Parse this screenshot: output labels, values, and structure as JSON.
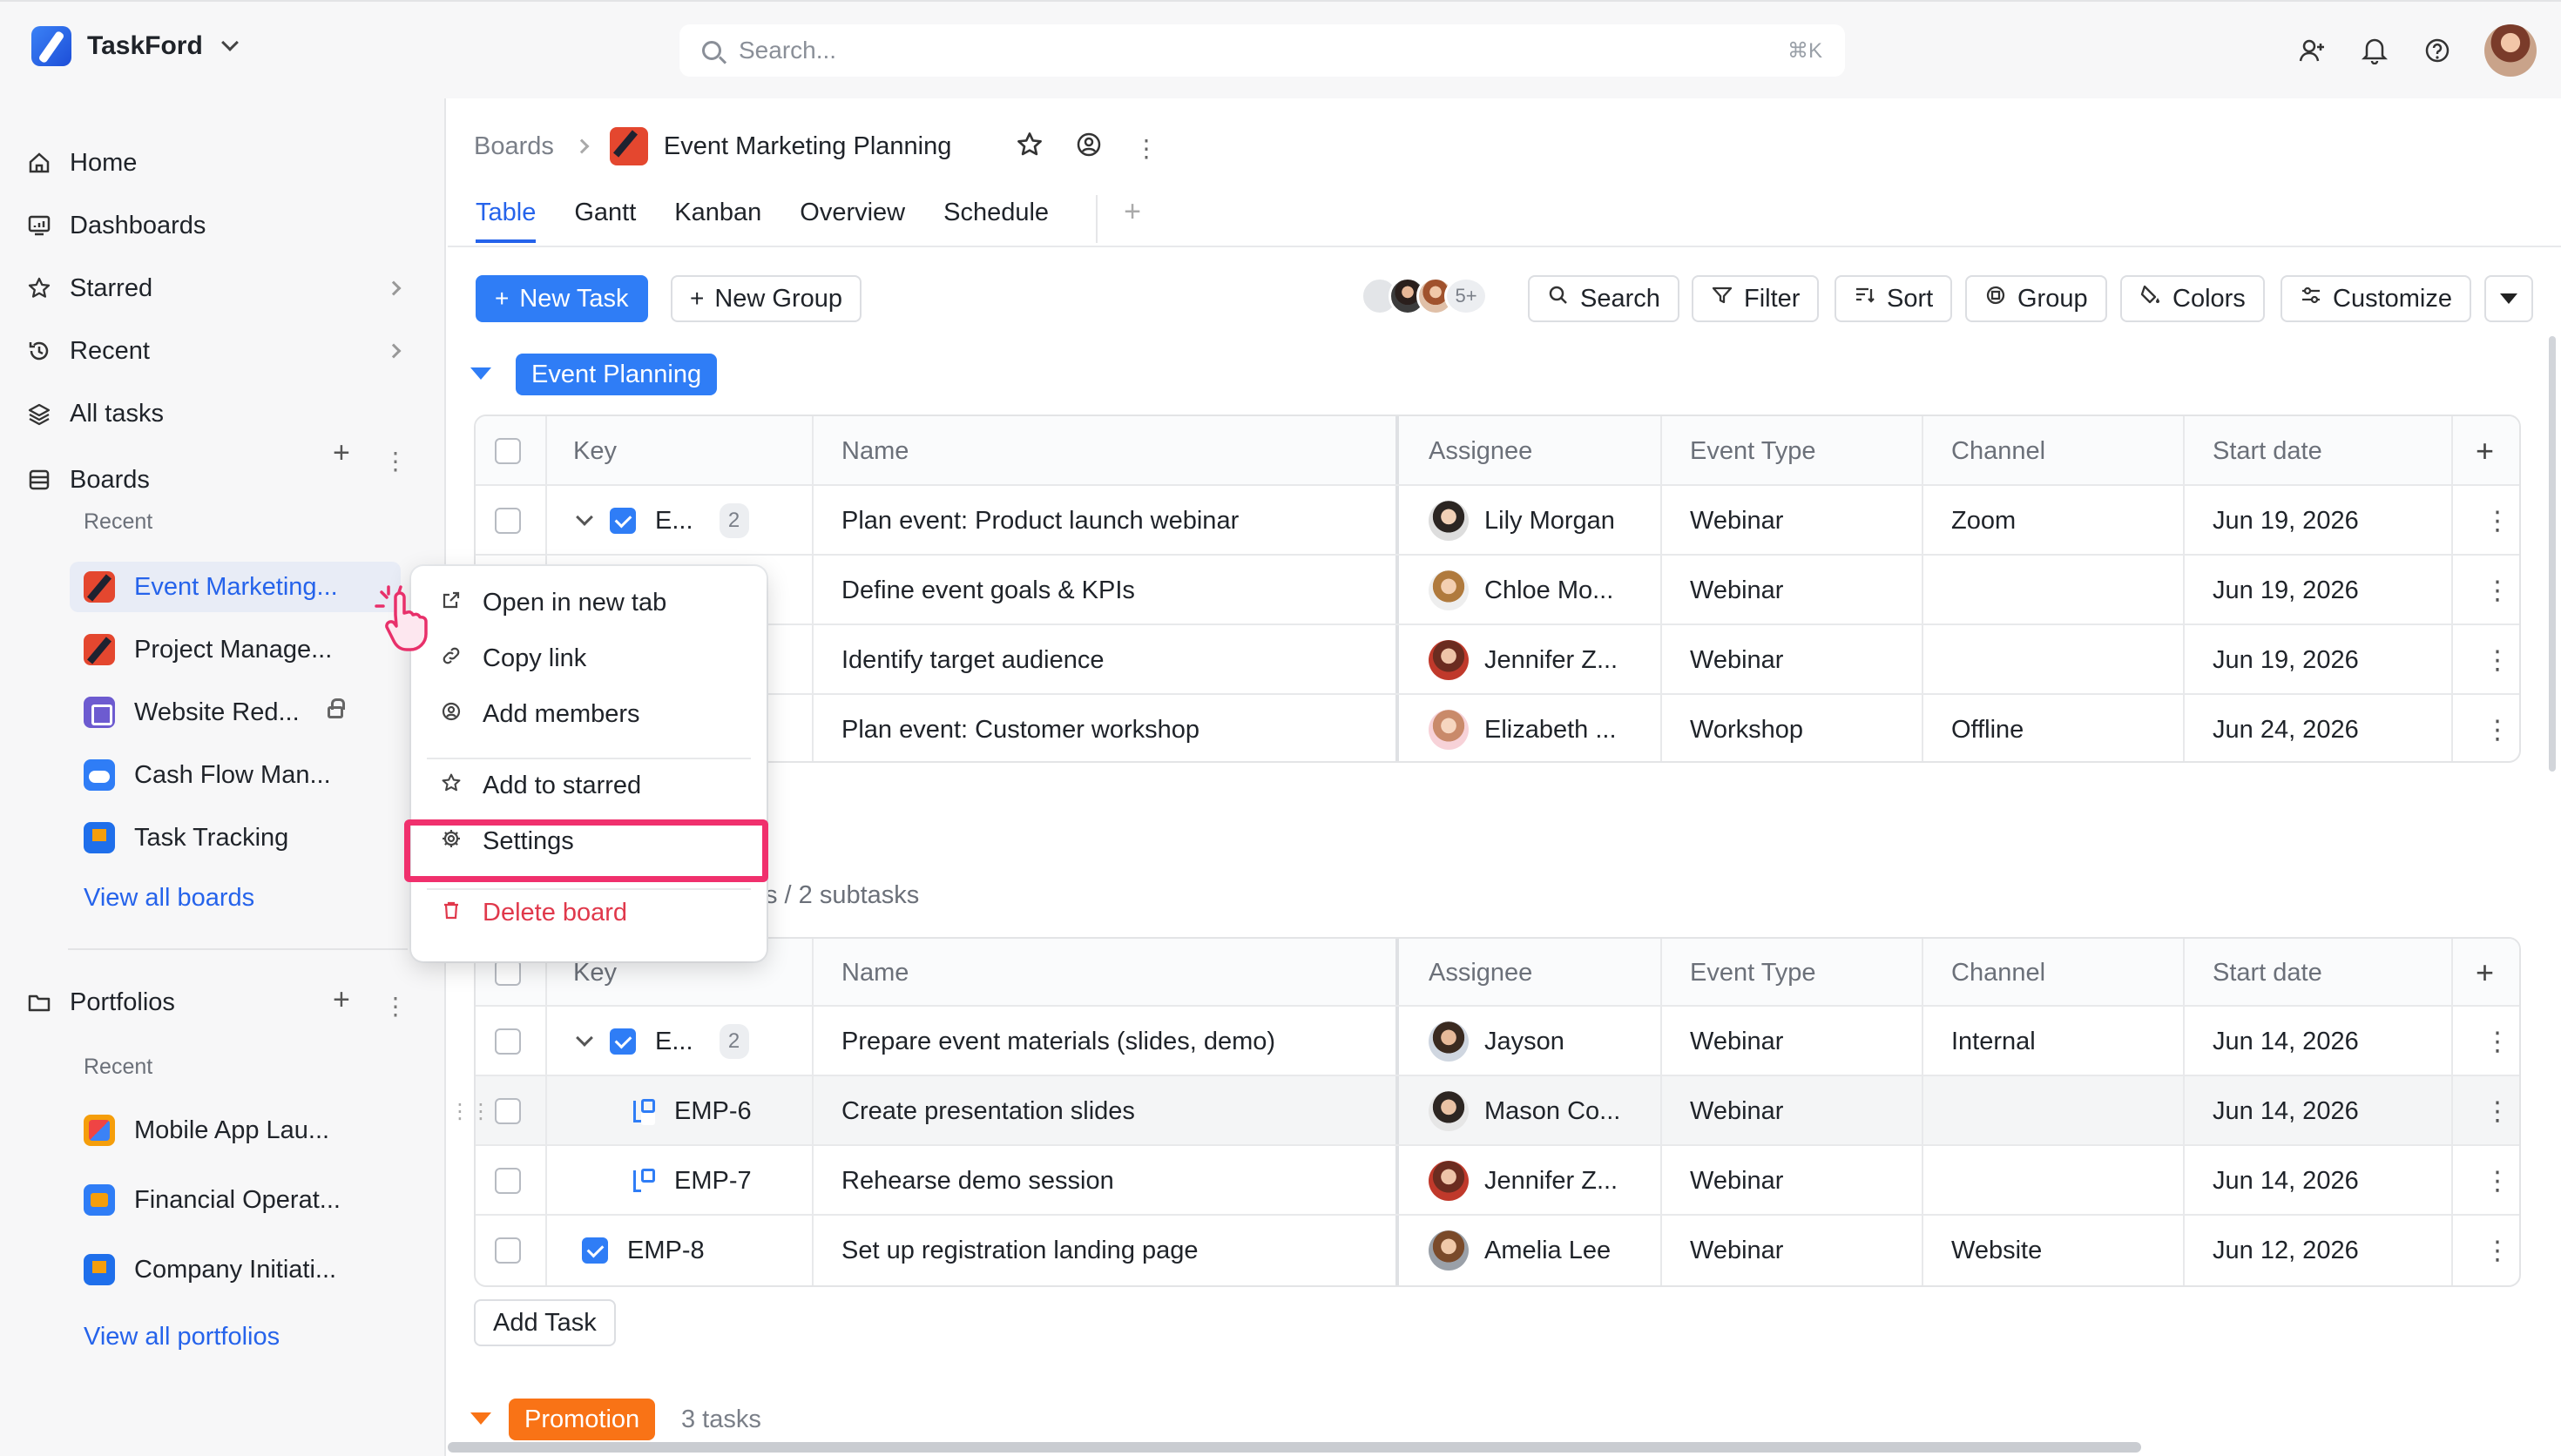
{
  "app": {
    "name": "TaskFord"
  },
  "search": {
    "placeholder": "Search...",
    "shortcut": "⌘K"
  },
  "sidebar": {
    "nav": [
      {
        "label": "Home"
      },
      {
        "label": "Dashboards"
      },
      {
        "label": "Starred"
      },
      {
        "label": "Recent"
      },
      {
        "label": "All tasks"
      }
    ],
    "boards": {
      "title": "Boards",
      "recent_label": "Recent",
      "items": [
        {
          "label": "Event Marketing..."
        },
        {
          "label": "Project Manage..."
        },
        {
          "label": "Website Red..."
        },
        {
          "label": "Cash Flow Man..."
        },
        {
          "label": "Task Tracking"
        }
      ],
      "view_all": "View all boards"
    },
    "portfolios": {
      "title": "Portfolios",
      "recent_label": "Recent",
      "items": [
        {
          "label": "Mobile App Lau..."
        },
        {
          "label": "Financial Operat..."
        },
        {
          "label": "Company Initiati..."
        }
      ],
      "view_all": "View all portfolios"
    }
  },
  "header": {
    "breadcrumb_root": "Boards",
    "board_title": "Event Marketing Planning",
    "tabs": [
      "Table",
      "Gantt",
      "Kanban",
      "Overview",
      "Schedule"
    ],
    "active_tab": "Table"
  },
  "toolbar": {
    "new_task": "New Task",
    "new_group": "New Group",
    "members_more": "5+",
    "search": "Search",
    "filter": "Filter",
    "sort": "Sort",
    "group": "Group",
    "colors": "Colors",
    "customize": "Customize"
  },
  "columns": [
    "Key",
    "Name",
    "Assignee",
    "Event Type",
    "Channel",
    "Start date"
  ],
  "groups": [
    {
      "name": "Event Planning",
      "color": "#2f7df6",
      "rows": [
        {
          "key": "E...",
          "subcount": "2",
          "name": "Plan event: Product launch webinar",
          "assignee": "Lily Morgan",
          "event_type": "Webinar",
          "channel": "Zoom",
          "start": "Jun 19, 2026"
        },
        {
          "name": "Define event goals & KPIs",
          "assignee": "Chloe Mo...",
          "event_type": "Webinar",
          "channel": "",
          "start": "Jun 19, 2026"
        },
        {
          "name": "Identify target audience",
          "assignee": "Jennifer Z...",
          "event_type": "Webinar",
          "channel": "",
          "start": "Jun 19, 2026"
        },
        {
          "name": "Plan event: Customer workshop",
          "assignee": "Elizabeth ...",
          "event_type": "Workshop",
          "channel": "Offline",
          "start": "Jun 24, 2026"
        }
      ]
    },
    {
      "summary": "s / 2 subtasks",
      "rows": [
        {
          "key": "E...",
          "subcount": "2",
          "name": "Prepare event materials (slides, demo)",
          "assignee": "Jayson",
          "event_type": "Webinar",
          "channel": "Internal",
          "start": "Jun 14, 2026"
        },
        {
          "key": "EMP-6",
          "name": "Create presentation slides",
          "assignee": "Mason Co...",
          "event_type": "Webinar",
          "channel": "",
          "start": "Jun 14, 2026"
        },
        {
          "key": "EMP-7",
          "name": "Rehearse demo session",
          "assignee": "Jennifer Z...",
          "event_type": "Webinar",
          "channel": "",
          "start": "Jun 14, 2026"
        },
        {
          "key": "EMP-8",
          "name": "Set up registration landing page",
          "assignee": "Amelia Lee",
          "event_type": "Webinar",
          "channel": "Website",
          "start": "Jun 12, 2026"
        }
      ],
      "add_task": "Add Task"
    },
    {
      "name": "Promotion",
      "color": "#f97316",
      "count": "3 tasks"
    }
  ],
  "context_menu": {
    "items": [
      {
        "label": "Open in new tab",
        "icon": "external-link-icon"
      },
      {
        "label": "Copy link",
        "icon": "link-icon"
      },
      {
        "label": "Add members",
        "icon": "members-icon"
      },
      {
        "label": "Add to starred",
        "icon": "star-icon"
      },
      {
        "label": "Settings",
        "icon": "gear-icon"
      },
      {
        "label": "Delete board",
        "icon": "trash-icon"
      }
    ]
  },
  "colors": {
    "accent": "#2f7df6",
    "danger": "#e0384b",
    "highlight": "#f0306d",
    "promotion": "#f97316"
  }
}
